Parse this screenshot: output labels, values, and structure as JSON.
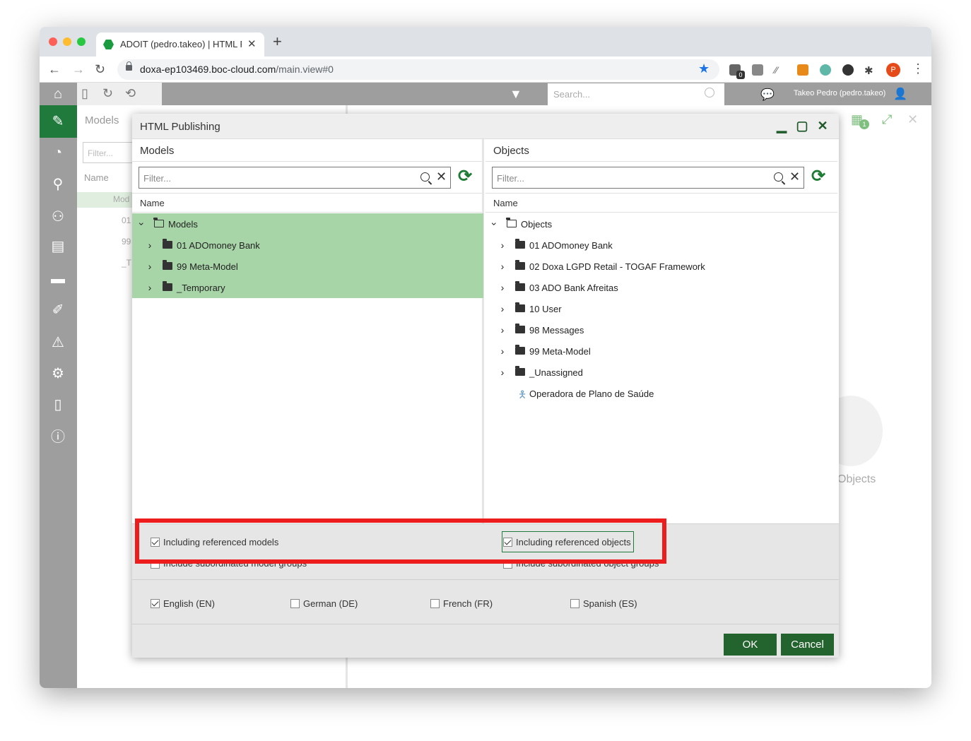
{
  "browser": {
    "tab_title": "ADOIT (pedro.takeo) | HTML R",
    "url_host": "doxa-ep103469.boc-cloud.com",
    "url_path": "/main.view#0",
    "profile_initial": "P",
    "ext_badge": "0"
  },
  "app": {
    "search_placeholder": "Search...",
    "user_label": "Takeo Pedro (pedro.takeo)",
    "bg_models_title": "Models",
    "bg_filter_placeholder": "Filter...",
    "bg_name_header": "Name",
    "bg_rows": [
      "Mod",
      "01",
      "99",
      "_T"
    ],
    "bg_objects_label": "Objects",
    "right_badge": "1"
  },
  "dialog": {
    "title": "HTML Publishing",
    "models_pane": {
      "title": "Models",
      "filter_placeholder": "Filter...",
      "column": "Name",
      "root": "Models",
      "children": [
        "01 ADOmoney Bank",
        "99 Meta-Model",
        "_Temporary"
      ]
    },
    "objects_pane": {
      "title": "Objects",
      "filter_placeholder": "Filter...",
      "column": "Name",
      "root": "Objects",
      "children": [
        "01 ADOmoney Bank",
        "02 Doxa LGPD Retail - TOGAF Framework",
        "03 ADO Bank Afreitas",
        "10 User",
        "98 Messages",
        "99 Meta-Model",
        "_Unassigned"
      ],
      "leaf": "Operadora de Plano de Saúde"
    },
    "options": {
      "incl_ref_models": "Including referenced models",
      "incl_ref_objects": "Including referenced objects",
      "incl_sub_models": "Include subordinated model groups",
      "incl_sub_objects": "Include subordinated object groups"
    },
    "languages": [
      "English (EN)",
      "German (DE)",
      "French (FR)",
      "Spanish (ES)"
    ],
    "ok_label": "OK",
    "cancel_label": "Cancel"
  },
  "colors": {
    "accent_green": "#1f7a3c",
    "selection_green": "#a8d5a8",
    "highlight_red": "#ee1d1d",
    "sidebar_gray": "#9e9e9e"
  }
}
